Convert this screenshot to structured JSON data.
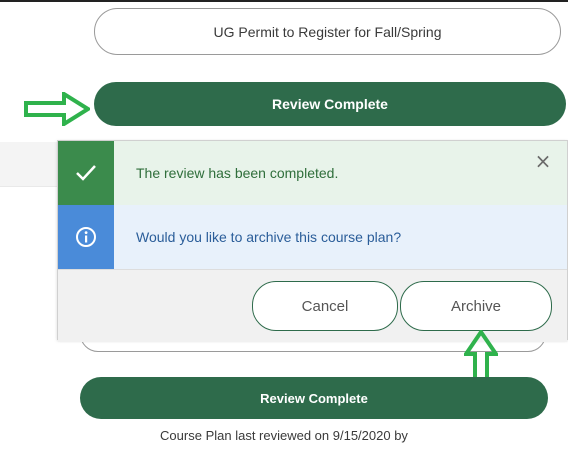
{
  "buttons": {
    "ug_permit": "UG Permit to Register for Fall/Spring",
    "review_complete_top": "Review Complete",
    "review_complete_bottom": "Review Complete"
  },
  "popup": {
    "success_message": "The review has been completed.",
    "info_message": "Would you like to archive this course plan?",
    "close_symbol": "×",
    "cancel_label": "Cancel",
    "archive_label": "Archive"
  },
  "footer": {
    "last_reviewed": "Course Plan last reviewed on 9/15/2020 by"
  },
  "icons": {
    "success": "check-icon",
    "info": "info-icon",
    "annotation": "green-arrow-icon"
  },
  "colors": {
    "brand_green": "#2e6b4b",
    "success_green": "#3b8b4c",
    "info_blue": "#4a8bd9",
    "annotation_green": "#2fb24c"
  }
}
